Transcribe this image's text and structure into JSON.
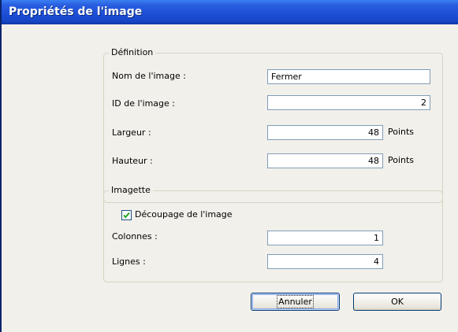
{
  "window": {
    "title": "Propriétés de l'image"
  },
  "definition": {
    "legend": "Définition",
    "name_label": "Nom de l'image :",
    "name_value": "Fermer",
    "id_label": "ID de l'image :",
    "id_value": "2",
    "width_label": "Largeur :",
    "width_value": "48",
    "width_unit": "Points",
    "height_label": "Hauteur :",
    "height_value": "48",
    "height_unit": "Points"
  },
  "thumbnail": {
    "legend": "Imagette",
    "split_label": "Découpage de l'image",
    "split_checked": true,
    "columns_label": "Colonnes :",
    "columns_value": "1",
    "rows_label": "Lignes :",
    "rows_value": "4"
  },
  "buttons": {
    "cancel": "Annuler",
    "ok": "OK"
  },
  "colors": {
    "titlebar": "#1E4FD8",
    "client": "#F2F0EA",
    "field_border": "#7F9DB9",
    "check": "#21A121"
  }
}
